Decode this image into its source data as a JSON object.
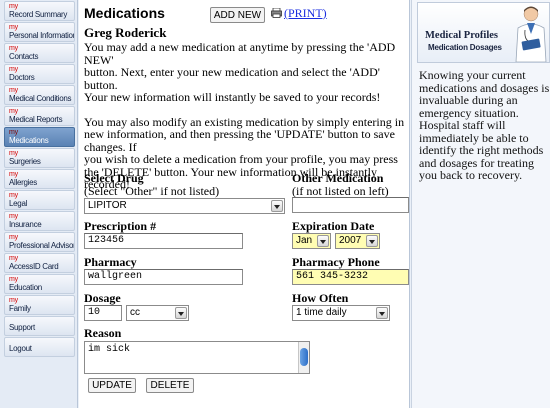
{
  "sidebar": {
    "items": [
      {
        "my": "my",
        "label": "Record Summary",
        "active": false
      },
      {
        "my": "my",
        "label": "Personal Information",
        "active": false
      },
      {
        "my": "my",
        "label": "Contacts",
        "active": false
      },
      {
        "my": "my",
        "label": "Doctors",
        "active": false
      },
      {
        "my": "my",
        "label": "Medical Conditions",
        "active": false
      },
      {
        "my": "my",
        "label": "Medical Reports",
        "active": false
      },
      {
        "my": "my",
        "label": "Medications",
        "active": true
      },
      {
        "my": "my",
        "label": "Surgeries",
        "active": false
      },
      {
        "my": "my",
        "label": "Allergies",
        "active": false
      },
      {
        "my": "my",
        "label": "Legal",
        "active": false
      },
      {
        "my": "my",
        "label": "Insurance",
        "active": false
      },
      {
        "my": "my",
        "label": "Professional Advisor",
        "active": false
      },
      {
        "my": "my",
        "label": "AccessID Card",
        "active": false
      },
      {
        "my": "my",
        "label": "Education",
        "active": false
      },
      {
        "my": "my",
        "label": "Family",
        "active": false
      },
      {
        "my": "",
        "label": "Support",
        "active": false
      },
      {
        "my": "",
        "label": "Logout",
        "active": false
      }
    ]
  },
  "main": {
    "title": "Medications",
    "add_new_label": "ADD NEW",
    "print_label": "(PRINT)",
    "user_name": "Greg Roderick",
    "para1_line1": "You may add a new medication at anytime by pressing the 'ADD NEW'",
    "para1_line2": "button. Next, enter your new medication and select the 'ADD' button.",
    "para1_line3": "Your new information will instantly be saved to your records!",
    "para2_line1": "You may also modify an existing medication by simply entering in new information, and then pressing the 'UPDATE' button to save changes. If",
    "para2_line2": "you wish to delete a medication from your profile, you may press the 'DELETE' button. Your new information will be instantly recorded!"
  },
  "form": {
    "select_drug_label": "Select Drug",
    "select_drug_sub": "(Select \"Other\" if not listed)",
    "select_drug_value": "LIPITOR",
    "other_med_label": "Other Medication",
    "other_med_sub": "(if not listed on left)",
    "other_med_value": "",
    "prescription_label": "Prescription #",
    "prescription_value": "123456",
    "expiration_label": "Expiration Date",
    "exp_month": "Jan",
    "exp_year": "2007",
    "pharmacy_label": "Pharmacy",
    "pharmacy_value": "wallgreen",
    "pharmacy_phone_label": "Pharmacy Phone",
    "pharmacy_phone_value": "561 345-3232",
    "dosage_label": "Dosage",
    "dosage_value": "10",
    "dosage_unit": "cc",
    "how_often_label": "How Often",
    "how_often_value": "1 time daily",
    "reason_label": "Reason",
    "reason_value": "im sick",
    "update_label": "UPDATE",
    "delete_label": "DELETE"
  },
  "right_panel": {
    "banner_title": "Medical Profiles",
    "banner_sub": "Medication Dosages",
    "text": "Knowing your current medications and dosages is invaluable during an emergency situation. Hospital staff will immediately be able to identify the right methods and dosages for treating you back to recovery."
  },
  "colors": {
    "highlight_field": "#fffdb3",
    "link": "#1a2ee0",
    "nav_my": "#d40000",
    "nav_active": "#5a82b4"
  }
}
